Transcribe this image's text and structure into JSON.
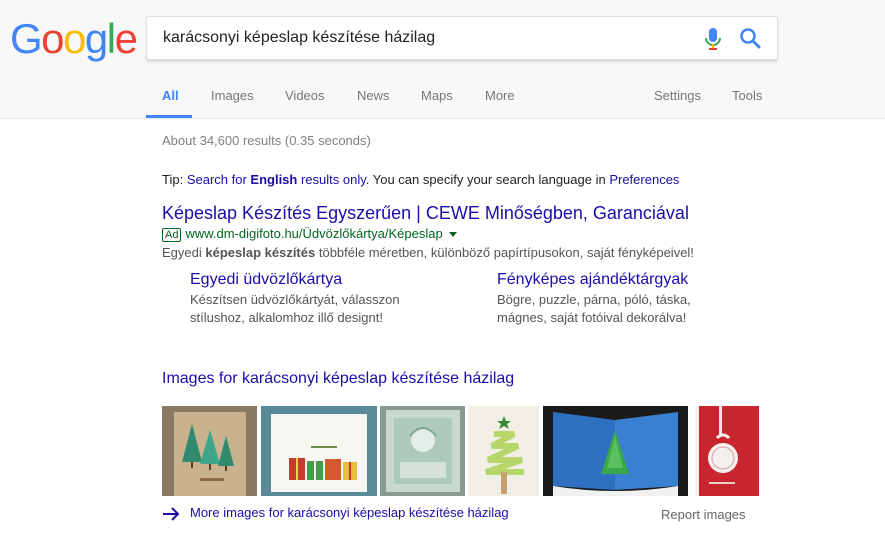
{
  "logo": {
    "letters": [
      "G",
      "o",
      "o",
      "g",
      "l",
      "e"
    ],
    "colors": [
      "#4285f4",
      "#ea4335",
      "#fbbc05",
      "#4285f4",
      "#34a853",
      "#ea4335"
    ]
  },
  "search": {
    "query": "karácsonyi képeslap készítése házilag"
  },
  "tabs": {
    "all": "All",
    "images": "Images",
    "videos": "Videos",
    "news": "News",
    "maps": "Maps",
    "more": "More",
    "settings": "Settings",
    "tools": "Tools"
  },
  "stats": "About 34,600 results (0.35 seconds)",
  "tip": {
    "prefix": "Tip: ",
    "search_for": "Search for ",
    "english": "English",
    "results_only": " results only",
    "suffix": ". You can specify your search language in ",
    "preferences": "Preferences"
  },
  "ad": {
    "title": "Képeslap Készítés Egyszerűen | CEWE Minőségben, Garanciával",
    "badge": "Ad",
    "url": "www.dm-digifoto.hu/Üdvözlőkártya/Képeslap",
    "desc_prefix": "Egyedi ",
    "desc_bold": "képeslap készítés",
    "desc_suffix": " többféle méretben, különböző papírtípusokon, saját fényképeivel!",
    "sitelinks": [
      {
        "title": "Egyedi üdvözlőkártya",
        "desc": "Készítsen üdvözlőkártyát, válasszon stílushoz, alkalomhoz illő designt!"
      },
      {
        "title": "Fényképes ajándéktárgyak",
        "desc": "Bögre, puzzle, párna, póló, táska, mágnes, saját fotóival dekorálva!"
      }
    ]
  },
  "images": {
    "header": "Images for karácsonyi képeslap készítése házilag",
    "more_link": "More images for karácsonyi képeslap készítése házilag",
    "report": "Report images"
  },
  "colors": {
    "link": "#1a0dab",
    "url": "#006621",
    "accent": "#4285f4"
  }
}
